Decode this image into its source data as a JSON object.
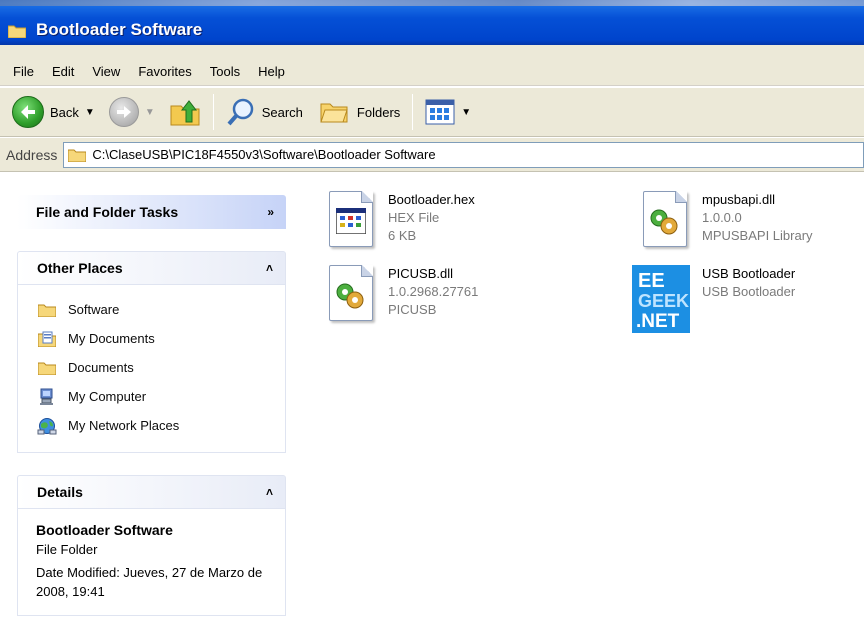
{
  "window": {
    "title": "Bootloader Software"
  },
  "menu": [
    "File",
    "Edit",
    "View",
    "Favorites",
    "Tools",
    "Help"
  ],
  "toolbar": {
    "back_label": "Back",
    "search_label": "Search",
    "folders_label": "Folders"
  },
  "address": {
    "label": "Address",
    "path": "C:\\ClaseUSB\\PIC18F4550v3\\Software\\Bootloader Software"
  },
  "tasks": {
    "file_folder_tasks": {
      "title": "File and Folder Tasks"
    },
    "other_places": {
      "title": "Other Places",
      "items": [
        {
          "label": "Software",
          "icon": "folder-icon"
        },
        {
          "label": "My Documents",
          "icon": "my-documents-icon"
        },
        {
          "label": "Documents",
          "icon": "folder-icon"
        },
        {
          "label": "My Computer",
          "icon": "my-computer-icon"
        },
        {
          "label": "My Network Places",
          "icon": "network-places-icon"
        }
      ]
    },
    "details": {
      "title": "Details",
      "name": "Bootloader Software",
      "type": "File Folder",
      "modified": "Date Modified: Jueves, 27 de Marzo de 2008, 19:41"
    }
  },
  "files": [
    {
      "name": "Bootloader.hex",
      "line2": "HEX File",
      "line3": "6 KB",
      "icon": "hex-file-icon"
    },
    {
      "name": "mpusbapi.dll",
      "line2": "1.0.0.0",
      "line3": "MPUSBAPI Library",
      "icon": "dll-file-icon"
    },
    {
      "name": "PICUSB.dll",
      "line2": "1.0.2968.27761",
      "line3": "PICUSB",
      "icon": "dll-file-icon"
    },
    {
      "name": "USB Bootloader",
      "line2": "USB Bootloader",
      "line3": "",
      "icon": "eegeek-app-icon"
    }
  ],
  "colors": {
    "title_bar": "#0550d6",
    "task_pane_bg": "#6f8fe0",
    "task_header_text": "#215dc6",
    "task_body": "#d6dff7",
    "eegeek_blue": "#1c8fe3"
  }
}
